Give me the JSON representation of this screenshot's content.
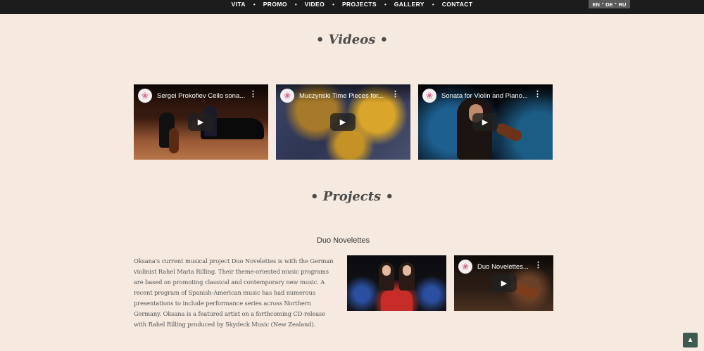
{
  "nav": {
    "items": [
      "VITA",
      "PROMO",
      "VIDEO",
      "PROJECTS",
      "GALLERY",
      "CONTACT"
    ],
    "separator": "•"
  },
  "languages": {
    "items": [
      "EN",
      "DE",
      "RU"
    ],
    "separator": "•",
    "active": "EN"
  },
  "sections": {
    "videos_title": "• Videos •",
    "projects_title": "• Projects •"
  },
  "videos": [
    {
      "title": "Sergei Prokofiev Cello sona...",
      "menu_icon": "⋮",
      "play_icon": "▶"
    },
    {
      "title": "Muczynski Time Pieces for...",
      "menu_icon": "⋮",
      "play_icon": "▶"
    },
    {
      "title": "Sonata for Violin and Piano...",
      "menu_icon": "⋮",
      "play_icon": "▶"
    }
  ],
  "project": {
    "name": "Duo Novelettes",
    "description": "Oksana's current musical project Duo Novelettes is with the German violinist Rahel Maria Rilling. Their theme-oriented music programs are based on promoting classical and contemporary new music. A recent program of Spanish-American music has had numerous presentations to include performance series across Northern Germany. Oksana is a featured artist on a forthcoming CD-release with Rahel Rilling produced by Skydeck Music (New Zealand).",
    "video": {
      "title": "Duo Novelettes...",
      "menu_icon": "⋮",
      "play_icon": "▶"
    }
  },
  "channel_avatar_icon": "❀",
  "back_to_top_icon": "▲",
  "colors": {
    "background": "#f5e9e0",
    "nav_bar": "#1c1c1c",
    "back_to_top": "#3d5a4e"
  }
}
